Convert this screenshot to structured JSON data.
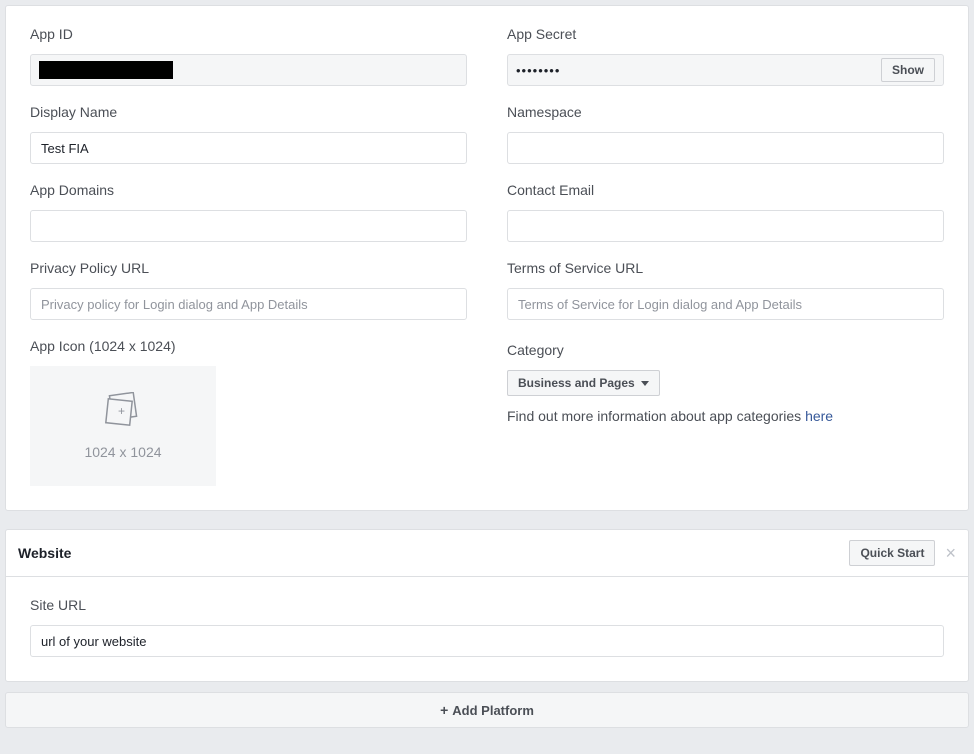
{
  "fields": {
    "app_id": {
      "label": "App ID",
      "value": ""
    },
    "app_secret": {
      "label": "App Secret",
      "value": "••••••••",
      "show_btn": "Show"
    },
    "display_name": {
      "label": "Display Name",
      "value": "Test FIA"
    },
    "namespace": {
      "label": "Namespace",
      "value": ""
    },
    "app_domains": {
      "label": "App Domains",
      "value": ""
    },
    "contact_email": {
      "label": "Contact Email",
      "value": ""
    },
    "privacy_url": {
      "label": "Privacy Policy URL",
      "placeholder": "Privacy policy for Login dialog and App Details",
      "value": ""
    },
    "tos_url": {
      "label": "Terms of Service URL",
      "placeholder": "Terms of Service for Login dialog and App Details",
      "value": ""
    },
    "app_icon": {
      "label": "App Icon (1024 x 1024)",
      "hint": "1024 x 1024"
    },
    "category": {
      "label": "Category",
      "selected": "Business and Pages",
      "help_prefix": "Find out more information about app categories ",
      "help_link": "here"
    }
  },
  "website": {
    "title": "Website",
    "quick_start": "Quick Start",
    "site_url_label": "Site URL",
    "site_url_value": "url of your website"
  },
  "add_platform": "Add Platform"
}
